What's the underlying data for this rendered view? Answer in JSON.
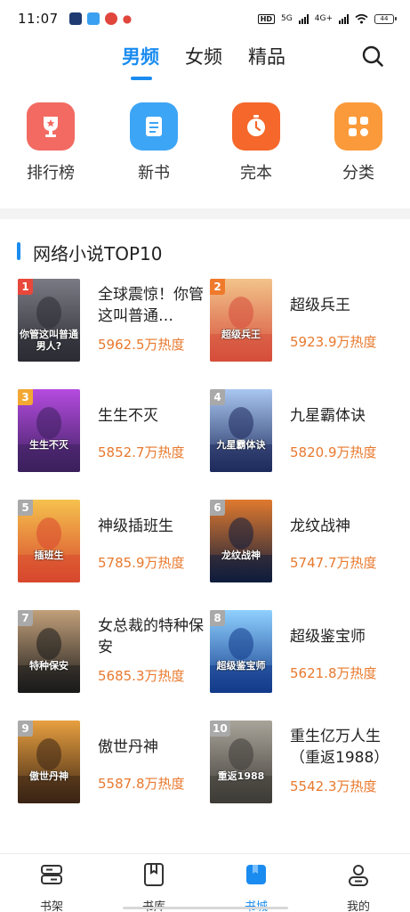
{
  "status_bar": {
    "time": "11:07",
    "network_5g": "5G",
    "network_4g": "4G+",
    "hd_badge": "HD",
    "battery": "44"
  },
  "header": {
    "tabs": [
      {
        "label": "男频",
        "active": true
      },
      {
        "label": "女频",
        "active": false
      },
      {
        "label": "精品",
        "active": false
      }
    ],
    "search_icon": "search-icon",
    "accent_color": "#1a8cf0"
  },
  "categories": [
    {
      "label": "排行榜",
      "icon": "trophy-icon",
      "color": "#f26a62"
    },
    {
      "label": "新书",
      "icon": "new-book-icon",
      "color": "#3da5f5"
    },
    {
      "label": "完本",
      "icon": "stopwatch-icon",
      "color": "#f5672a"
    },
    {
      "label": "分类",
      "icon": "category-grid-icon",
      "color": "#fb9a3a"
    }
  ],
  "section": {
    "title": "网络小说TOP10"
  },
  "books": [
    {
      "rank": "1",
      "title": "全球震惊！你管这叫普通…",
      "heat": "5962.5万热度",
      "cover_text": "你管这叫普通男人?"
    },
    {
      "rank": "2",
      "title": "超级兵王",
      "heat": "5923.9万热度",
      "cover_text": "超级兵王"
    },
    {
      "rank": "3",
      "title": "生生不灭",
      "heat": "5852.7万热度",
      "cover_text": "生生不灭"
    },
    {
      "rank": "4",
      "title": "九星霸体诀",
      "heat": "5820.9万热度",
      "cover_text": "九星霸体诀"
    },
    {
      "rank": "5",
      "title": "神级插班生",
      "heat": "5785.9万热度",
      "cover_text": "插班生"
    },
    {
      "rank": "6",
      "title": "龙纹战神",
      "heat": "5747.7万热度",
      "cover_text": "龙纹战神"
    },
    {
      "rank": "7",
      "title": "女总裁的特种保安",
      "heat": "5685.3万热度",
      "cover_text": "特种保安"
    },
    {
      "rank": "8",
      "title": "超级鉴宝师",
      "heat": "5621.8万热度",
      "cover_text": "超级鉴宝师"
    },
    {
      "rank": "9",
      "title": "傲世丹神",
      "heat": "5587.8万热度",
      "cover_text": "傲世丹神"
    },
    {
      "rank": "10",
      "title": "重生亿万人生（重返1988）",
      "heat": "5542.3万热度",
      "cover_text": "重返1988"
    }
  ],
  "bottom_nav": [
    {
      "label": "书架",
      "icon": "bookshelf-icon",
      "active": false
    },
    {
      "label": "书库",
      "icon": "library-icon",
      "active": false
    },
    {
      "label": "书城",
      "icon": "bookstore-icon",
      "active": true
    },
    {
      "label": "我的",
      "icon": "profile-icon",
      "active": false
    }
  ],
  "colors": {
    "heat_text": "#e8792e",
    "rank_1": "#e8483b",
    "rank_2": "#f07a2c",
    "rank_3": "#f3a833",
    "rank_other": "#a9a9a9"
  }
}
